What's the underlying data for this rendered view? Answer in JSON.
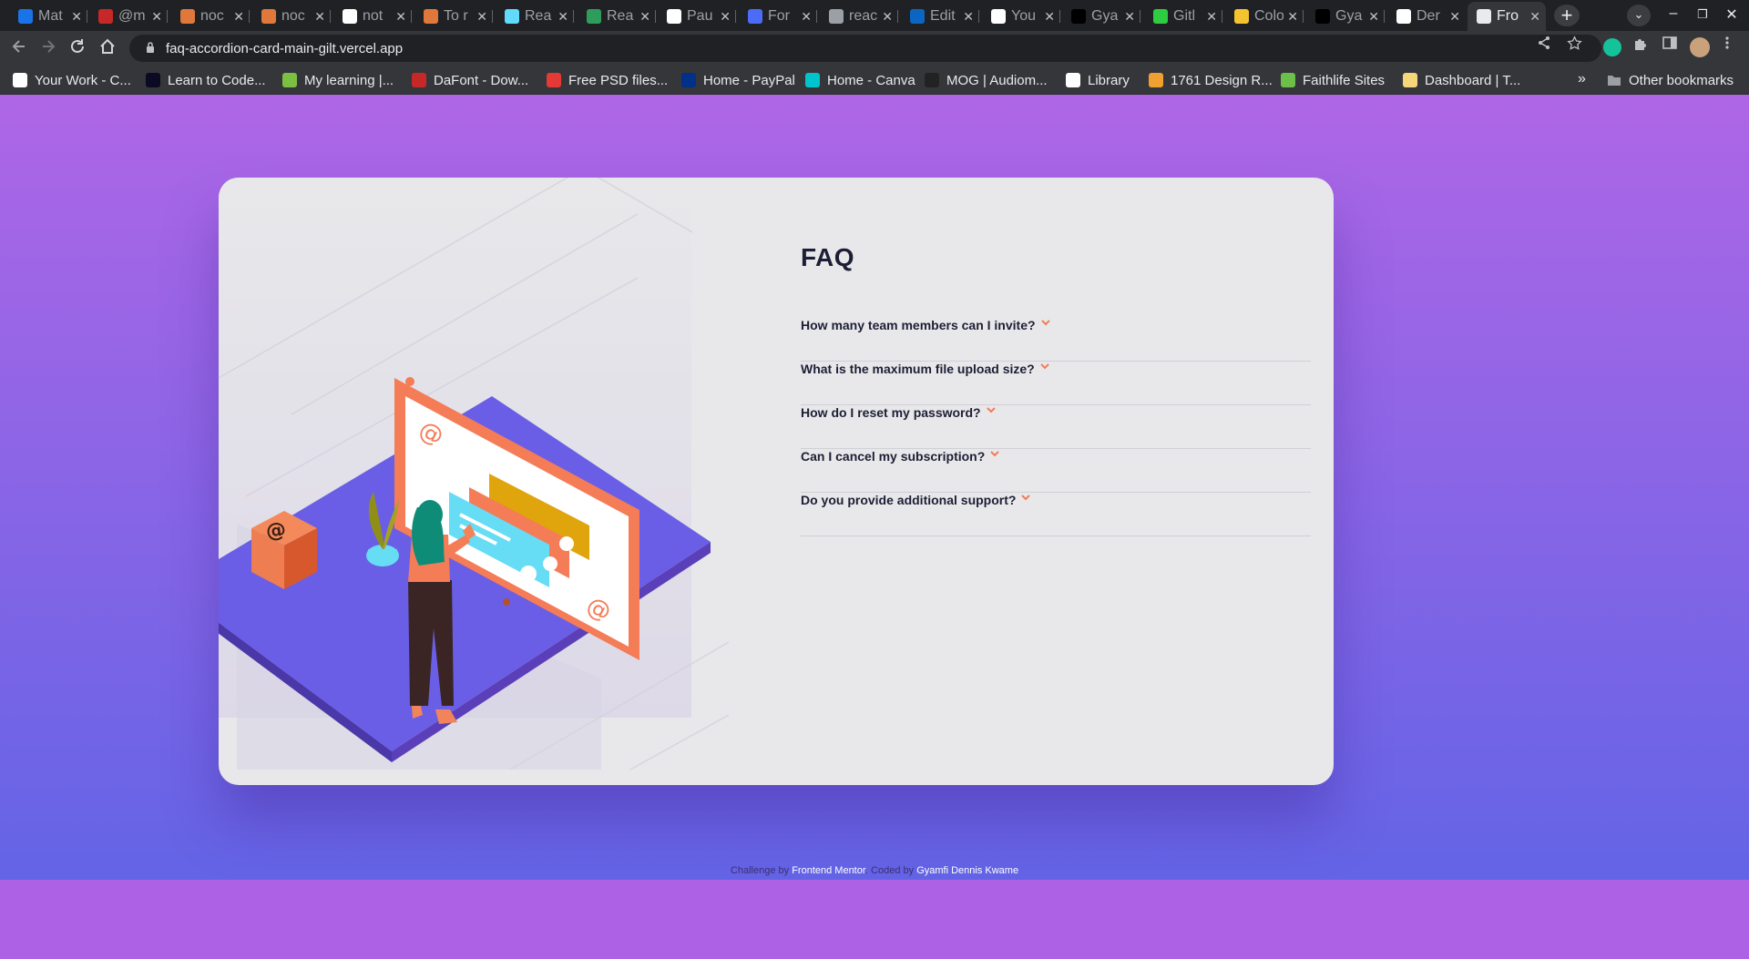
{
  "browser": {
    "tabs": [
      {
        "label": "Mat",
        "color": "#1a73e8"
      },
      {
        "label": "@m",
        "color": "#c62828"
      },
      {
        "label": "noc",
        "color": "#e0783c"
      },
      {
        "label": "noc",
        "color": "#e0783c"
      },
      {
        "label": "not",
        "color": "#ffffff"
      },
      {
        "label": "To r",
        "color": "#e0783c"
      },
      {
        "label": "Rea",
        "color": "#61dafb"
      },
      {
        "label": "Rea",
        "color": "#2e9d5c"
      },
      {
        "label": "Pau",
        "color": "#ffffff"
      },
      {
        "label": "For",
        "color": "#4a6cf7"
      },
      {
        "label": "reac",
        "color": "#9aa0a6"
      },
      {
        "label": "Edit",
        "color": "#0a66c2"
      },
      {
        "label": "You",
        "color": "#ffffff"
      },
      {
        "label": "Gya",
        "color": "#000000"
      },
      {
        "label": "Gitl",
        "color": "#2ecc40"
      },
      {
        "label": "Colo",
        "color": "#f4c430"
      },
      {
        "label": "Gya",
        "color": "#000000"
      },
      {
        "label": "Der",
        "color": "#ffffff"
      },
      {
        "label": "Fro",
        "color": "#e8eaed"
      }
    ],
    "new_tab": "+",
    "tab_search": "⌄",
    "win_minimize": "–",
    "win_restore": "❐",
    "win_close": "✕",
    "url": "faq-accordion-card-main-gilt.vercel.app",
    "bookmarks": [
      {
        "label": "Your Work - C...",
        "color": "#ffffff"
      },
      {
        "label": "Learn to Code...",
        "color": "#0a0a23"
      },
      {
        "label": "My learning |...",
        "color": "#7bc043"
      },
      {
        "label": "DaFont - Dow...",
        "color": "#c62828"
      },
      {
        "label": "Free PSD files...",
        "color": "#e53935"
      },
      {
        "label": "Home - PayPal",
        "color": "#003087"
      },
      {
        "label": "Home - Canva",
        "color": "#00c4cc"
      },
      {
        "label": "MOG | Audiom...",
        "color": "#222222"
      },
      {
        "label": "Library",
        "color": "#ffffff"
      },
      {
        "label": "1761 Design R...",
        "color": "#f0a030"
      },
      {
        "label": "Faithlife Sites",
        "color": "#6cc04a"
      },
      {
        "label": "Dashboard | T...",
        "color": "#f5d67a"
      }
    ],
    "bookmarks_more": "»",
    "other_bookmarks": "Other bookmarks"
  },
  "page": {
    "faq_title": "FAQ",
    "questions": [
      "How many team members can I invite?",
      "What is the maximum file upload size?",
      "How do I reset my password?",
      "Can I cancel my subscription?",
      "Do you provide additional support?"
    ],
    "attribution": {
      "prefix": "Challenge by ",
      "link1": "Frontend Mentor",
      "middle": ". Coded by ",
      "link2": "Gyamfi Dennis Kwame"
    },
    "colors": {
      "bg_top": "#ae66e6",
      "bg_bottom": "#6464e6",
      "card": "#e8e8ea",
      "title": "#1d1e35",
      "accent": "#f47c57"
    }
  }
}
